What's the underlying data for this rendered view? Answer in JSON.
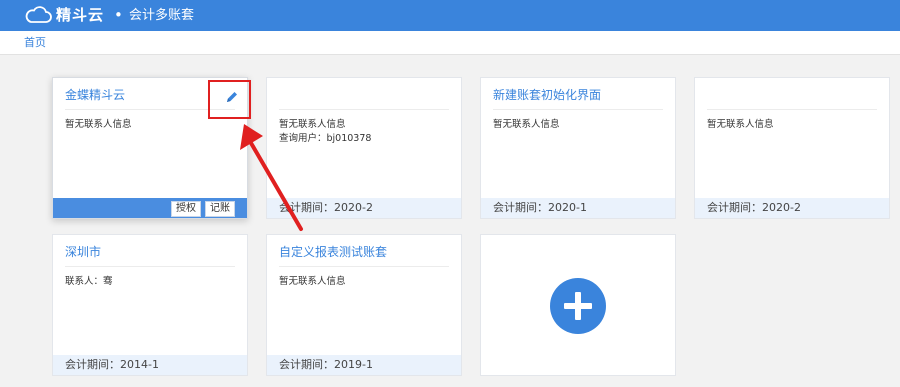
{
  "header": {
    "brand": "精斗云",
    "separator": "•",
    "title": "会计多账套"
  },
  "breadcrumb": {
    "home": "首页"
  },
  "cards": [
    {
      "title": "金蝶精斗云",
      "line1": "暂无联系人信息",
      "line2": "",
      "footer": "",
      "buttons": {
        "auth": "授权",
        "book": "记账"
      }
    },
    {
      "title": "",
      "line1": "暂无联系人信息",
      "line2": "查询用户：bj010378",
      "footer": "会计期间：2020-2"
    },
    {
      "title": "新建账套初始化界面",
      "line1": "暂无联系人信息",
      "line2": "",
      "footer": "会计期间：2020-1"
    },
    {
      "title": "",
      "line1": "暂无联系人信息",
      "line2": "",
      "footer": "会计期间：2020-2"
    },
    {
      "title": "深圳市",
      "line1": "联系人：骞",
      "line2": "",
      "footer": "会计期间：2014-1"
    },
    {
      "title": "自定义报表测试账套",
      "line1": "暂无联系人信息",
      "line2": "",
      "footer": "会计期间：2019-1"
    }
  ],
  "colors": {
    "primary": "#3a84dc",
    "highlight": "#e02020",
    "footer_bg": "#eaf2fc"
  },
  "icons": [
    "cloud-logo-icon",
    "edit-pencil-icon",
    "plus-icon"
  ]
}
